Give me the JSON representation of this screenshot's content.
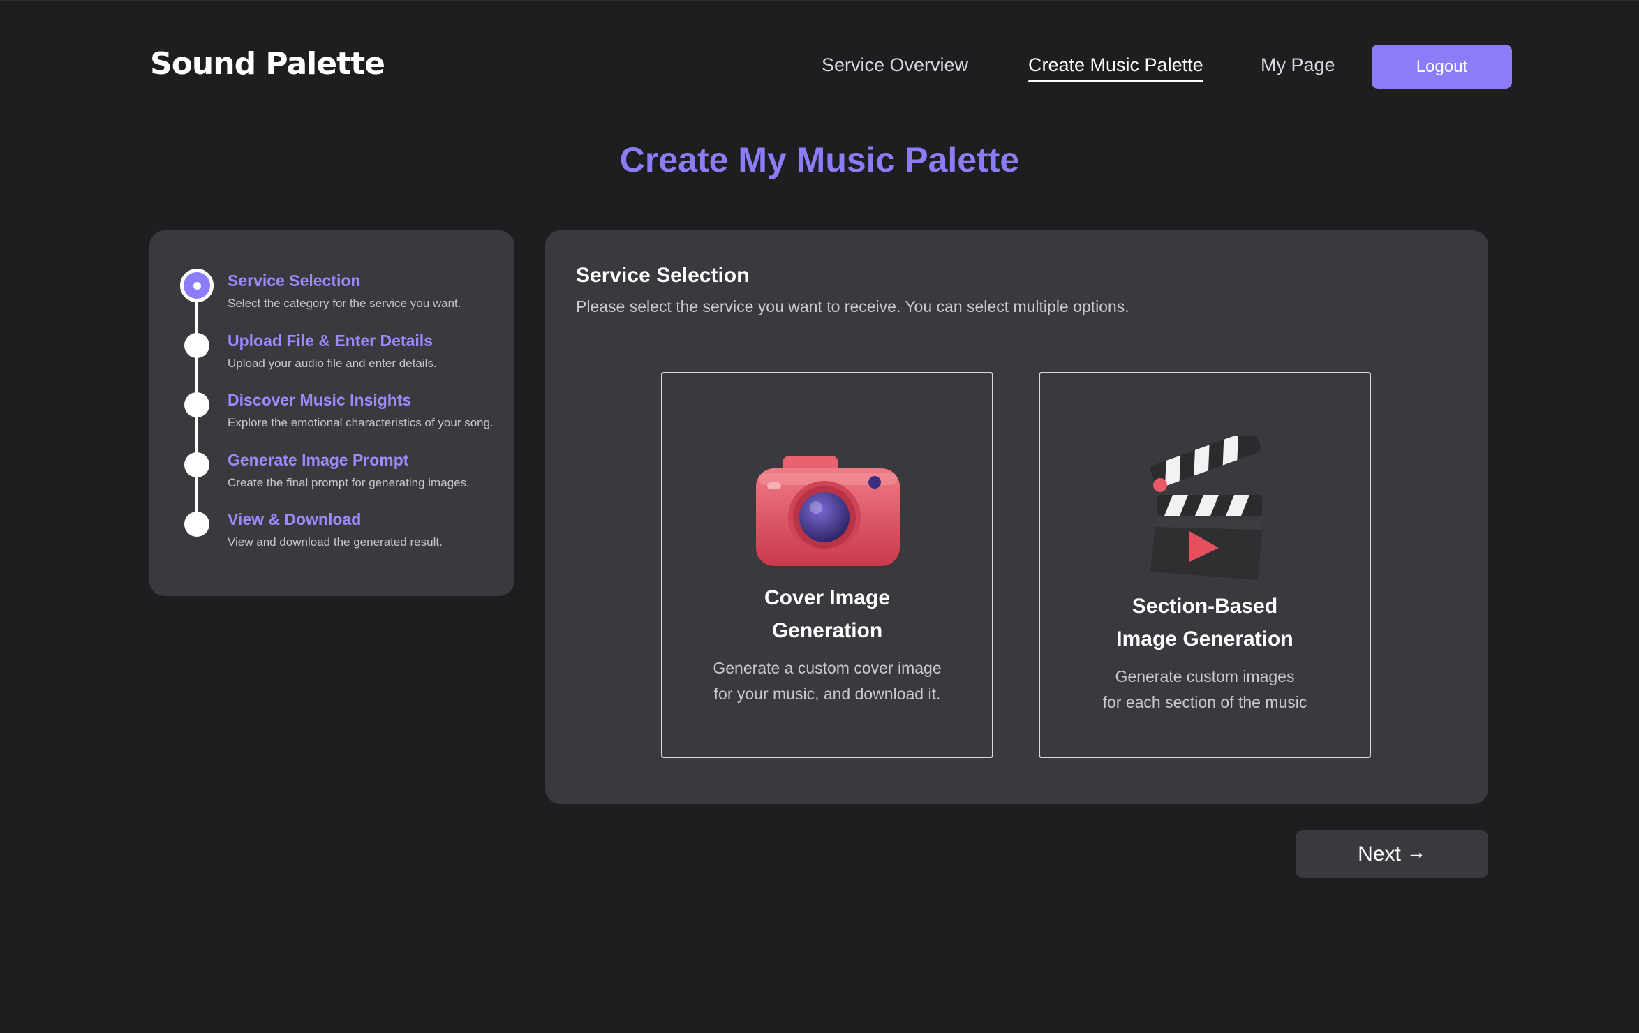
{
  "header": {
    "logo": "Sound Palette",
    "nav": [
      {
        "label": "Service Overview",
        "active": false
      },
      {
        "label": "Create Music Palette",
        "active": true
      },
      {
        "label": "My Page",
        "active": false
      }
    ],
    "logout_label": "Logout"
  },
  "page_title": "Create My Music Palette",
  "steps": [
    {
      "title": "Service Selection",
      "desc": "Select the category for the service you want.",
      "current": true
    },
    {
      "title": "Upload File & Enter Details",
      "desc": "Upload your audio file and enter details.",
      "current": false
    },
    {
      "title": "Discover Music Insights",
      "desc": "Explore the emotional characteristics of your song.",
      "current": false
    },
    {
      "title": "Generate Image Prompt",
      "desc": "Create the final prompt for generating images.",
      "current": false
    },
    {
      "title": "View & Download",
      "desc": "View and download the generated result.",
      "current": false
    }
  ],
  "panel": {
    "title": "Service Selection",
    "subtitle": "Please select the service you want to receive. You can select multiple options."
  },
  "services": [
    {
      "icon": "camera-icon",
      "title_lines": [
        "Cover Image",
        "Generation"
      ],
      "desc_lines": [
        "Generate a custom cover image",
        "for your music, and download it."
      ]
    },
    {
      "icon": "clapperboard-icon",
      "title_lines": [
        "Section-Based",
        "Image Generation"
      ],
      "desc_lines": [
        "Generate custom images",
        "for each section of the music"
      ]
    }
  ],
  "next_label": "Next",
  "next_arrow": "→",
  "colors": {
    "background": "#1e1e21",
    "panel": "#3a393e",
    "accent": "#8b7cf8",
    "step_title": "#9a8cff"
  }
}
